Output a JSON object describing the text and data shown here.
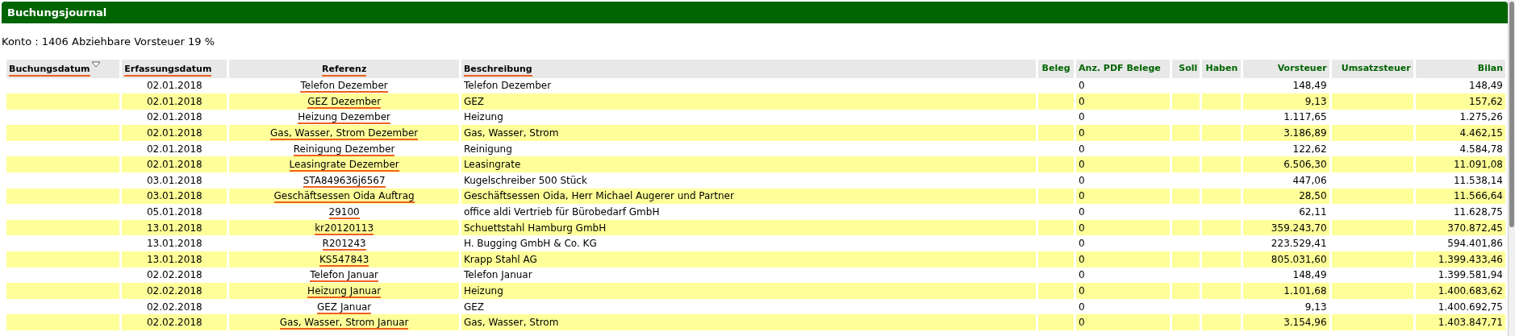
{
  "title": "Buchungsjournal",
  "konto": "Konto : 1406 Abziehbare Vorsteuer 19 %",
  "columns": [
    {
      "label": "Buchungsdatum",
      "kind": "link",
      "sorted": true
    },
    {
      "label": "Erfassungsdatum",
      "kind": "link"
    },
    {
      "label": "Referenz",
      "kind": "link"
    },
    {
      "label": "Beschreibung",
      "kind": "link"
    },
    {
      "label": "Beleg",
      "kind": "plain"
    },
    {
      "label": "Anz. PDF Belege",
      "kind": "plain"
    },
    {
      "label": "Soll",
      "kind": "plain"
    },
    {
      "label": "Haben",
      "kind": "plain"
    },
    {
      "label": "Vorsteuer",
      "kind": "plain"
    },
    {
      "label": "Umsatzsteuer",
      "kind": "plain"
    },
    {
      "label": "Bilan",
      "kind": "plain"
    }
  ],
  "rows": [
    {
      "erfassungsdatum": "02.01.2018",
      "referenz": "Telefon Dezember",
      "beschreibung": "Telefon Dezember",
      "anz_pdf_belege": "0",
      "vorsteuer": "148,49",
      "bilanz": "148,49"
    },
    {
      "erfassungsdatum": "02.01.2018",
      "referenz": "GEZ Dezember",
      "beschreibung": "GEZ",
      "anz_pdf_belege": "0",
      "vorsteuer": "9,13",
      "bilanz": "157,62"
    },
    {
      "erfassungsdatum": "02.01.2018",
      "referenz": "Heizung Dezember",
      "beschreibung": "Heizung",
      "anz_pdf_belege": "0",
      "vorsteuer": "1.117,65",
      "bilanz": "1.275,26"
    },
    {
      "erfassungsdatum": "02.01.2018",
      "referenz": "Gas, Wasser, Strom Dezember",
      "beschreibung": "Gas, Wasser, Strom",
      "anz_pdf_belege": "0",
      "vorsteuer": "3.186,89",
      "bilanz": "4.462,15"
    },
    {
      "erfassungsdatum": "02.01.2018",
      "referenz": "Reinigung Dezember",
      "beschreibung": "Reinigung",
      "anz_pdf_belege": "0",
      "vorsteuer": "122,62",
      "bilanz": "4.584,78"
    },
    {
      "erfassungsdatum": "02.01.2018",
      "referenz": "Leasingrate Dezember",
      "beschreibung": "Leasingrate",
      "anz_pdf_belege": "0",
      "vorsteuer": "6.506,30",
      "bilanz": "11.091,08"
    },
    {
      "erfassungsdatum": "03.01.2018",
      "referenz": "STA849636j6567",
      "beschreibung": "Kugelschreiber 500 Stück",
      "anz_pdf_belege": "0",
      "vorsteuer": "447,06",
      "bilanz": "11.538,14"
    },
    {
      "erfassungsdatum": "03.01.2018",
      "referenz": "Geschäftsessen Oida Auftrag",
      "beschreibung": "Geschäftsessen Oida, Herr Michael Augerer und Partner",
      "anz_pdf_belege": "0",
      "vorsteuer": "28,50",
      "bilanz": "11.566,64"
    },
    {
      "erfassungsdatum": "05.01.2018",
      "referenz": "29100",
      "beschreibung": "office aldi Vertrieb für Bürobedarf GmbH",
      "anz_pdf_belege": "0",
      "vorsteuer": "62,11",
      "bilanz": "11.628,75"
    },
    {
      "erfassungsdatum": "13.01.2018",
      "referenz": "kr20120113",
      "beschreibung": "Schuettstahl Hamburg GmbH",
      "anz_pdf_belege": "0",
      "vorsteuer": "359.243,70",
      "bilanz": "370.872,45"
    },
    {
      "erfassungsdatum": "13.01.2018",
      "referenz": "R201243",
      "beschreibung": "H. Bugging GmbH & Co. KG",
      "anz_pdf_belege": "0",
      "vorsteuer": "223.529,41",
      "bilanz": "594.401,86"
    },
    {
      "erfassungsdatum": "13.01.2018",
      "referenz": "KS547843",
      "beschreibung": "Krapp Stahl AG",
      "anz_pdf_belege": "0",
      "vorsteuer": "805.031,60",
      "bilanz": "1.399.433,46"
    },
    {
      "erfassungsdatum": "02.02.2018",
      "referenz": "Telefon Januar",
      "beschreibung": "Telefon Januar",
      "anz_pdf_belege": "0",
      "vorsteuer": "148,49",
      "bilanz": "1.399.581,94"
    },
    {
      "erfassungsdatum": "02.02.2018",
      "referenz": "Heizung Januar",
      "beschreibung": "Heizung",
      "anz_pdf_belege": "0",
      "vorsteuer": "1.101,68",
      "bilanz": "1.400.683,62"
    },
    {
      "erfassungsdatum": "02.02.2018",
      "referenz": "GEZ Januar",
      "beschreibung": "GEZ",
      "anz_pdf_belege": "0",
      "vorsteuer": "9,13",
      "bilanz": "1.400.692,75"
    },
    {
      "erfassungsdatum": "02.02.2018",
      "referenz": "Gas, Wasser, Strom Januar",
      "beschreibung": "Gas, Wasser, Strom",
      "anz_pdf_belege": "0",
      "vorsteuer": "3.154,96",
      "bilanz": "1.403.847,71"
    }
  ]
}
